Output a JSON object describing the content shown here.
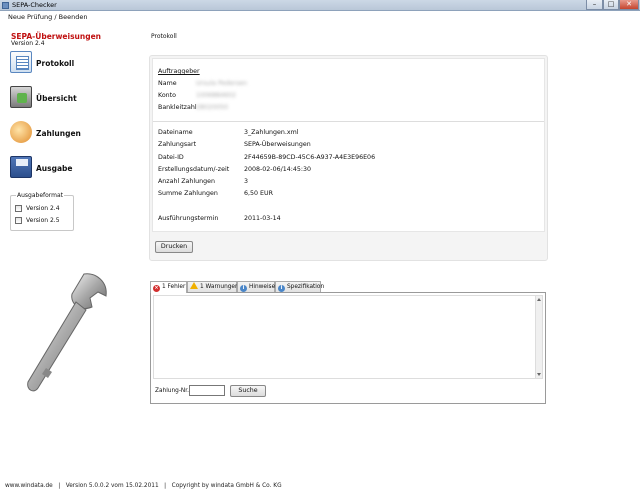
{
  "window": {
    "title": "SEPA-Checker",
    "min_label": "–",
    "max_label": "□",
    "close_label": "✕"
  },
  "menu": {
    "item": "Neue Prüfung / Beenden"
  },
  "app": {
    "name": "SEPA-Überweisungen",
    "version": "Version 2.4"
  },
  "nav": [
    {
      "label": "Protokoll",
      "icon": "document-icon"
    },
    {
      "label": "Übersicht",
      "icon": "overview-icon"
    },
    {
      "label": "Zahlungen",
      "icon": "coins-icon"
    },
    {
      "label": "Ausgabe",
      "icon": "floppy-disk-icon"
    }
  ],
  "format": {
    "legend": "Ausgabeformat",
    "options": [
      {
        "label": "Version 2.4",
        "checked": false
      },
      {
        "label": "Version 2.5",
        "checked": false
      }
    ]
  },
  "section": {
    "title": "Protokoll"
  },
  "auftraggeber": {
    "heading": "Auftraggeber",
    "name_label": "Name",
    "name_value": "Ursula Pedersen",
    "konto_label": "Konto",
    "konto_value": "1006884602",
    "blz_label": "Bankleitzahl",
    "blz_value": "28020050"
  },
  "details": [
    {
      "label": "Dateiname",
      "value": "3_Zahlungen.xml"
    },
    {
      "label": "Zahlungsart",
      "value": "SEPA-Überweisungen"
    },
    {
      "label": "Datei-ID",
      "value": "2F44659B-89CD-45C6-A937-A4E3E96E06"
    },
    {
      "label": "Erstellungsdatum/-zeit",
      "value": "2008-02-06/14:45:30"
    },
    {
      "label": "Anzahl Zahlungen",
      "value": "3"
    },
    {
      "label": "Summe Zahlungen",
      "value": "6,50 EUR"
    },
    {
      "label": "Ausführungstermin",
      "value": "2011-03-14"
    }
  ],
  "buttons": {
    "print": "Drucken",
    "search": "Suche"
  },
  "tabs": [
    {
      "label": "1 Fehler",
      "icon": "error-icon"
    },
    {
      "label": "1 Warnungen",
      "icon": "warning-icon"
    },
    {
      "label": "Hinweise",
      "icon": "info-icon"
    },
    {
      "label": "Spezifikation",
      "icon": "info-icon"
    }
  ],
  "search": {
    "label": "Zahlung-Nr.:",
    "value": ""
  },
  "footer": {
    "text": "www.windata.de   |   Version 5.0.0.2 vom 15.02.2011   |   Copyright by windata GmbH & Co. KG"
  },
  "colors": {
    "accent": "#c01010"
  }
}
